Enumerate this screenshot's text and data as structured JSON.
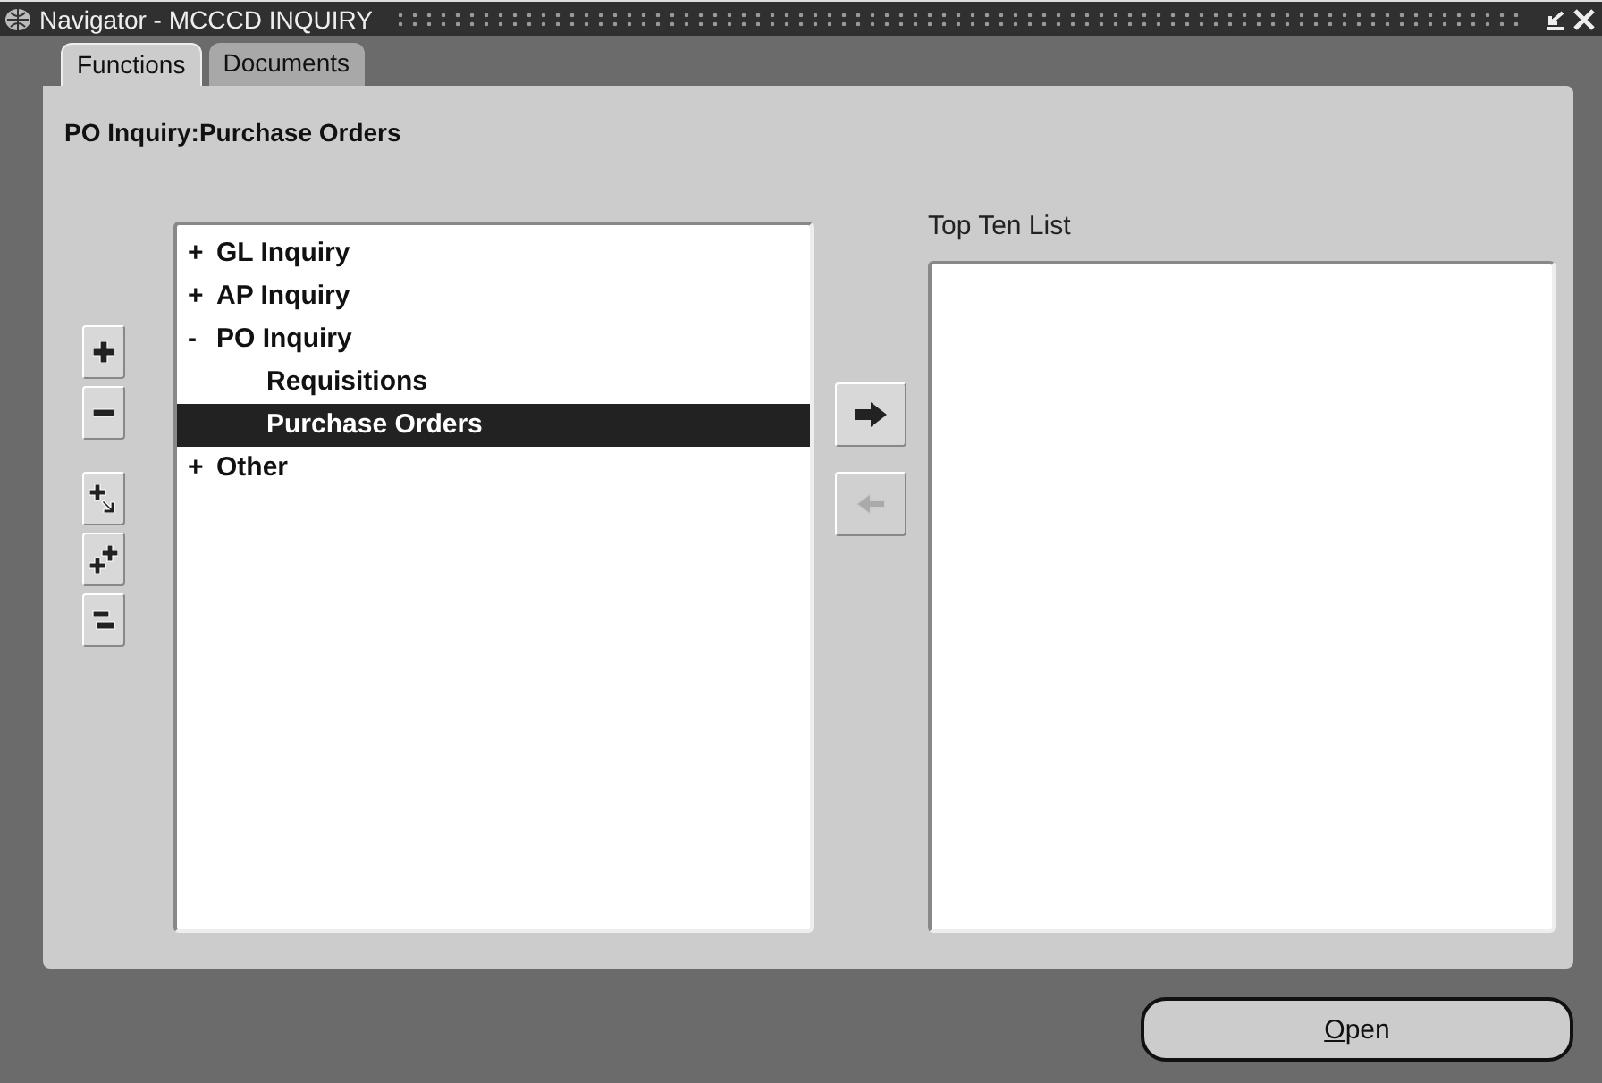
{
  "window": {
    "title": "Navigator - MCCCD INQUIRY"
  },
  "tabs": [
    {
      "label": "Functions",
      "selected": true
    },
    {
      "label": "Documents",
      "selected": false
    }
  ],
  "heading": "PO Inquiry:Purchase Orders",
  "tree": [
    {
      "toggle": "+",
      "label": "GL Inquiry",
      "selected": false
    },
    {
      "toggle": "+",
      "label": "AP Inquiry",
      "selected": false
    },
    {
      "toggle": "-",
      "label": "PO Inquiry",
      "selected": false,
      "children": [
        {
          "label": "Requisitions",
          "selected": false
        },
        {
          "label": "Purchase Orders",
          "selected": true
        }
      ]
    },
    {
      "toggle": "+",
      "label": "Other",
      "selected": false
    }
  ],
  "side_buttons": [
    {
      "kind": "expand",
      "disabled": false
    },
    {
      "kind": "collapse",
      "disabled": false
    },
    {
      "kind": "expand-branch",
      "disabled": false
    },
    {
      "kind": "expand-all",
      "disabled": false
    },
    {
      "kind": "collapse-all",
      "disabled": false
    }
  ],
  "move_buttons": [
    {
      "kind": "add",
      "disabled": false
    },
    {
      "kind": "remove",
      "disabled": true
    }
  ],
  "top_ten": {
    "label": "Top Ten List"
  },
  "open_button": {
    "label": "Open",
    "mnemonic_first": true
  }
}
